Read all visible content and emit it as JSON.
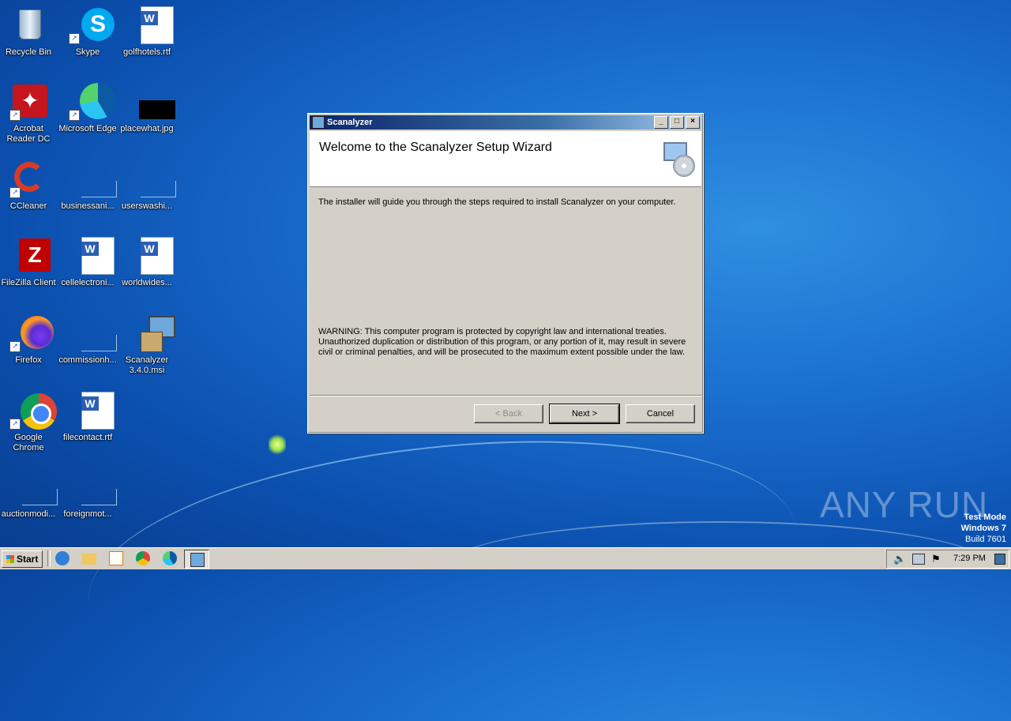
{
  "desktop": {
    "icons": [
      {
        "label": "Recycle Bin"
      },
      {
        "label": "Skype"
      },
      {
        "label": "golfhotels.rtf"
      },
      {
        "label": "Acrobat Reader DC"
      },
      {
        "label": "Microsoft Edge"
      },
      {
        "label": "placewhat.jpg"
      },
      {
        "label": "CCleaner"
      },
      {
        "label": "businessani..."
      },
      {
        "label": "userswashi..."
      },
      {
        "label": "FileZilla Client"
      },
      {
        "label": "cellelectroni..."
      },
      {
        "label": "worldwides..."
      },
      {
        "label": "Firefox"
      },
      {
        "label": "commissionh..."
      },
      {
        "label": "Scanalyzer 3.4.0.msi"
      },
      {
        "label": "Google Chrome"
      },
      {
        "label": "filecontact.rtf"
      },
      {
        "label": "auctionmodi..."
      },
      {
        "label": "foreignmot..."
      }
    ]
  },
  "window": {
    "title": "Scanalyzer",
    "heading": "Welcome to the Scanalyzer Setup Wizard",
    "intro": "The installer will guide you through the steps required to install Scanalyzer on your computer.",
    "warning": "WARNING: This computer program is protected by copyright law and international treaties. Unauthorized duplication or distribution of this program, or any portion of it, may result in severe civil or criminal penalties, and will be prosecuted to the maximum extent possible under the law.",
    "buttons": {
      "back": "< Back",
      "next": "Next >",
      "cancel": "Cancel"
    },
    "caption_buttons": {
      "minimize": "_",
      "maximize": "□",
      "close": "×"
    }
  },
  "watermark": {
    "brand": "ANY RUN"
  },
  "os_badge": {
    "line1": "Test Mode",
    "line2": "Windows 7",
    "line3": "Build 7601"
  },
  "taskbar": {
    "start": "Start",
    "clock": "7:29 PM"
  },
  "colors": {
    "accent_title": "#0a246a",
    "wallpaper": "#1a6fcf"
  }
}
